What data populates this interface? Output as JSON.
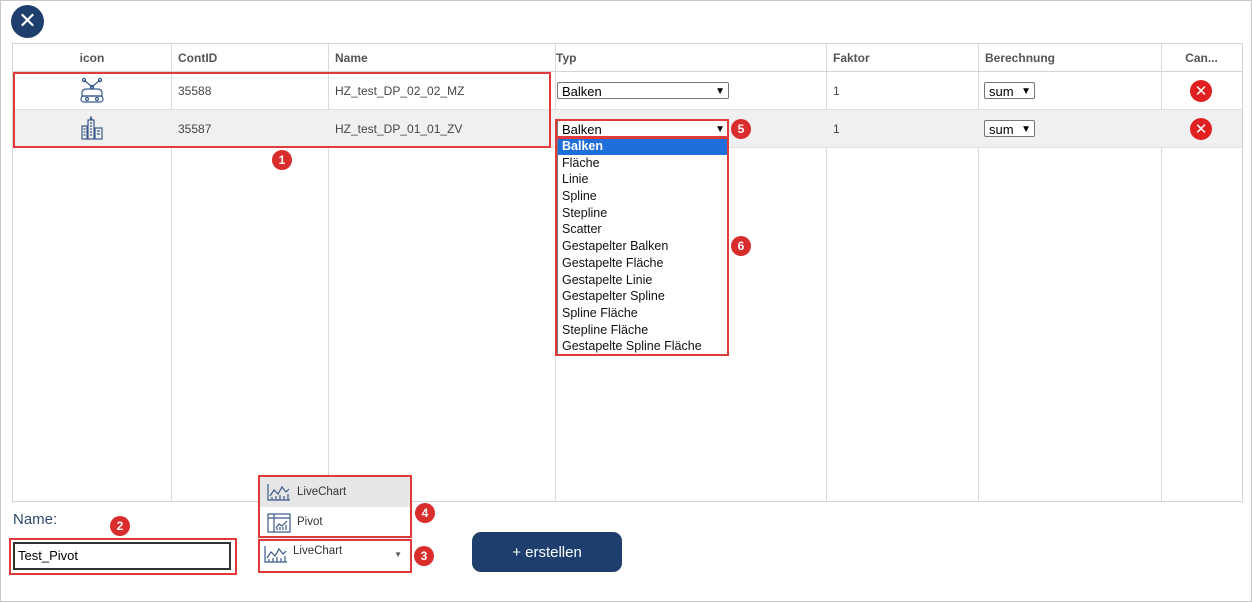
{
  "window": {
    "close_icon": "close-icon",
    "accent": "#1e3f6e"
  },
  "table": {
    "headers": [
      "icon",
      "ContID",
      "Name",
      "Typ",
      "Faktor",
      "Berechnung",
      "Can..."
    ],
    "rows": [
      {
        "icon": "robot-icon",
        "contid": "35588",
        "name": "HZ_test_DP_02_02_MZ",
        "typ": "Balken",
        "faktor": "1",
        "berechnung": "sum"
      },
      {
        "icon": "building-icon",
        "contid": "35587",
        "name": "HZ_test_DP_01_01_ZV",
        "typ": "Balken",
        "faktor": "1",
        "berechnung": "sum"
      }
    ]
  },
  "typ_dropdown": {
    "selected": "Balken",
    "options": [
      "Balken",
      "Fläche",
      "Linie",
      "Spline",
      "Stepline",
      "Scatter",
      "Gestapelter Balken",
      "Gestapelte Fläche",
      "Gestapelte Linie",
      "Gestapelter Spline",
      "Spline Fläche",
      "Stepline Fläche",
      "Gestapelte Spline Fläche"
    ]
  },
  "form": {
    "name_label": "Name:",
    "name_value": "Test_Pivot",
    "chart_type_selected": "LiveChart",
    "chart_type_options": [
      "LiveChart",
      "Pivot"
    ],
    "create_label": "+ erstellen"
  },
  "annotations": [
    "1",
    "2",
    "3",
    "4",
    "5",
    "6"
  ],
  "colors": {
    "highlight": "#e03a3a",
    "marker": "#d92c2c",
    "delete": "#e02020",
    "selected_option": "#1e6fd9"
  }
}
